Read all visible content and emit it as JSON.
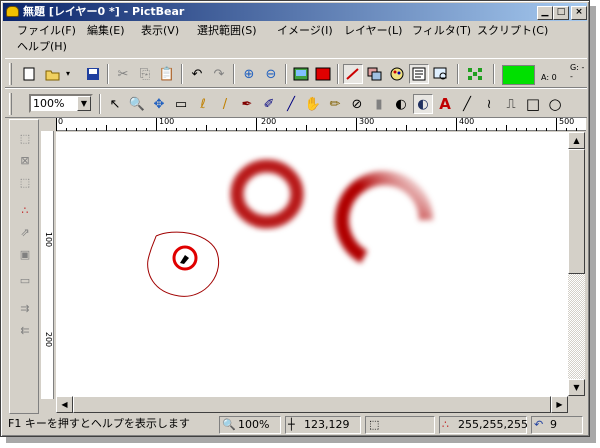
{
  "window": {
    "title": "無題 [レイヤー0 *] - PictBear",
    "min_glyph": "▁",
    "max_glyph": "□",
    "close_glyph": "×"
  },
  "menu": {
    "items": [
      "ファイル(F)",
      "編集(E)",
      "表示(V)",
      "選択範囲(S)",
      "イメージ(I)",
      "レイヤー(L)",
      "フィルタ(T)",
      "スクリプト(C)"
    ],
    "help": "ヘルプ(H)"
  },
  "toolbar": {
    "zoom_value": "100%",
    "zoom_arrow": "▼",
    "foreground_color": "#00e000",
    "alpha_label": "A: 0",
    "g_label": "G: --",
    "icons": [
      "new-icon",
      "open-icon",
      "save-icon",
      "cut-icon",
      "copy-icon",
      "paste-icon",
      "undo-icon",
      "redo-icon",
      "zoom-in-icon",
      "zoom-out-icon",
      "image-icon",
      "red-fill-icon",
      "brush-settings-icon",
      "layer-icon",
      "palette-icon",
      "properties-icon",
      "preview-icon",
      "grid-icon"
    ],
    "tools": [
      "↖",
      "🔍",
      "✥",
      "▭",
      "ℓ",
      "/",
      "✒",
      "✐",
      "╱",
      "✋",
      "✏",
      "⊘",
      "▮",
      "◐",
      "A",
      "╱",
      "≀",
      "⎍",
      "□",
      "○"
    ]
  },
  "rulers": {
    "top": [
      "0",
      "100",
      "200",
      "300",
      "400",
      "500"
    ],
    "left": [
      "100",
      "200"
    ]
  },
  "scroll": {
    "up": "▲",
    "down": "▼",
    "left": "◀",
    "right": "▶"
  },
  "status": {
    "help_text": "F1 キーを押すとヘルプを表示します",
    "zoom": "100%",
    "coords": "123,129",
    "color": "255,255,255",
    "undo_count": "9"
  },
  "colors": {
    "stroke_red": "#b00000",
    "titlebar_start": "#0a246a",
    "titlebar_end": "#a6caf0"
  }
}
